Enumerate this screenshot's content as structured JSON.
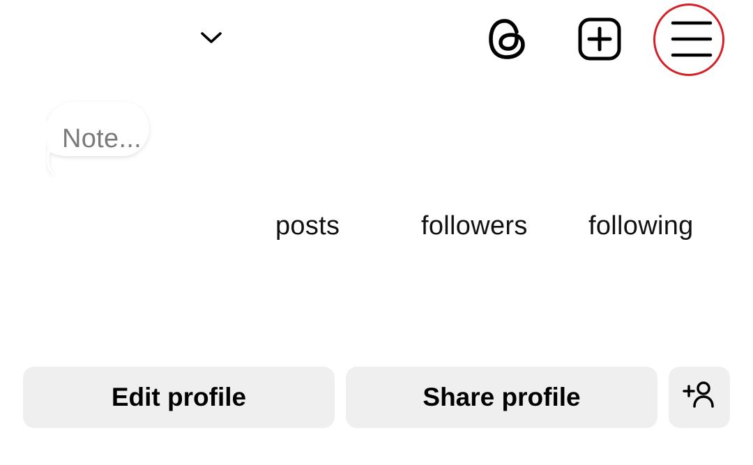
{
  "header": {
    "account_switcher_icon": "chevron-down-icon",
    "threads_icon": "threads-icon",
    "create_icon": "plus-square-icon",
    "menu_icon": "hamburger-menu-icon",
    "highlight_color": "#d42027"
  },
  "note": {
    "placeholder": "Note..."
  },
  "stats": {
    "posts_label": "posts",
    "followers_label": "followers",
    "following_label": "following"
  },
  "actions": {
    "edit_label": "Edit profile",
    "share_label": "Share profile",
    "add_user_icon": "add-person-icon",
    "button_bg": "#efefef"
  }
}
